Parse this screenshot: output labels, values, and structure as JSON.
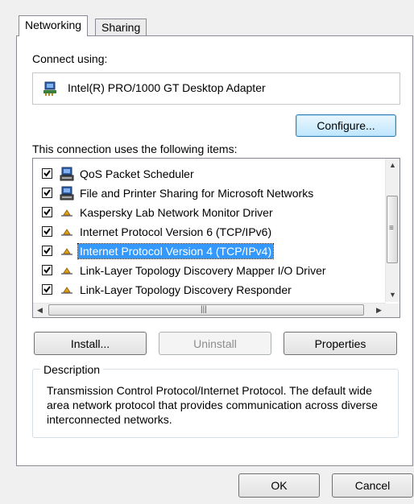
{
  "tabs": [
    {
      "label": "Networking",
      "active": true
    },
    {
      "label": "Sharing",
      "active": false
    }
  ],
  "connect_using_label": "Connect using:",
  "adapter": {
    "name": "Intel(R) PRO/1000 GT Desktop Adapter",
    "icon": "network-adapter-icon"
  },
  "configure_label": "Configure...",
  "items_label": "This connection uses the following items:",
  "items": [
    {
      "label": "QoS Packet Scheduler",
      "checked": true,
      "icon": "network-service-icon"
    },
    {
      "label": "File and Printer Sharing for Microsoft Networks",
      "checked": true,
      "icon": "network-service-icon"
    },
    {
      "label": "Kaspersky Lab Network Monitor Driver",
      "checked": true,
      "icon": "protocol-icon"
    },
    {
      "label": "Internet Protocol Version 6 (TCP/IPv6)",
      "checked": true,
      "icon": "protocol-icon"
    },
    {
      "label": "Internet Protocol Version 4 (TCP/IPv4)",
      "checked": true,
      "icon": "protocol-icon",
      "selected": true
    },
    {
      "label": "Link-Layer Topology Discovery Mapper I/O Driver",
      "checked": true,
      "icon": "protocol-icon"
    },
    {
      "label": "Link-Layer Topology Discovery Responder",
      "checked": true,
      "icon": "protocol-icon"
    }
  ],
  "buttons": {
    "install": "Install...",
    "uninstall": "Uninstall",
    "properties": "Properties",
    "ok": "OK",
    "cancel": "Cancel"
  },
  "description": {
    "title": "Description",
    "text": "Transmission Control Protocol/Internet Protocol. The default wide area network protocol that provides communication across diverse interconnected networks."
  },
  "colors": {
    "selection": "#3399ff",
    "border": "#898c95"
  }
}
